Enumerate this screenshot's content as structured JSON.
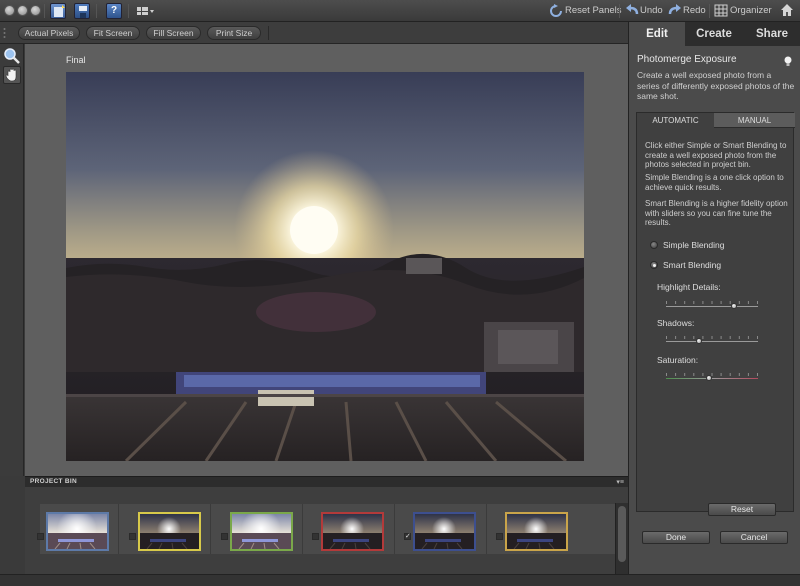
{
  "titlebar": {
    "reset_panels_label": "Reset Panels",
    "undo_label": "Undo",
    "redo_label": "Redo",
    "organizer_label": "Organizer"
  },
  "viewbar": {
    "buttons": [
      "Actual Pixels",
      "Fit Screen",
      "Fill Screen",
      "Print Size"
    ]
  },
  "canvas": {
    "label": "Final"
  },
  "project_bin": {
    "title": "PROJECT BIN",
    "menu_glyph": "▾≡",
    "thumbs": [
      {
        "border": "#5d7aa8",
        "checked": false,
        "bright": true
      },
      {
        "border": "#d7c94a",
        "checked": false,
        "bright": false
      },
      {
        "border": "#7aa84a",
        "checked": false,
        "bright": true
      },
      {
        "border": "#b33a3a",
        "checked": false,
        "bright": false
      },
      {
        "border": "#3d4f8f",
        "checked": true,
        "bright": false
      },
      {
        "border": "#c9a44a",
        "checked": false,
        "bright": false
      }
    ]
  },
  "panel": {
    "tabs": [
      "Edit",
      "Create",
      "Share"
    ],
    "title": "Photomerge Exposure",
    "description": "Create a well exposed photo from a series of differently exposed photos of the same shot.",
    "subtabs": [
      "AUTOMATIC",
      "MANUAL"
    ],
    "intro": "Click either Simple or Smart Blending to create a well exposed photo from the photos selected in project bin.",
    "simple_text": "Simple Blending is a one click option to achieve quick results.",
    "smart_text": "Smart Blending is a higher fidelity option with sliders so you can fine tune the results.",
    "radio_simple": "Simple Blending",
    "radio_smart": "Smart Blending",
    "selected_mode": "Smart Blending",
    "sliders": [
      {
        "label": "Highlight Details:",
        "value": 0.74
      },
      {
        "label": "Shadows:",
        "value": 0.36
      },
      {
        "label": "Saturation:",
        "value": 0.47
      }
    ],
    "reset_label": "Reset",
    "done_label": "Done",
    "cancel_label": "Cancel"
  },
  "colors": {
    "accent_active_tab": "#4b4b4b",
    "panel_bg": "#4b4b4b",
    "canvas_bg": "#5f5f5f"
  }
}
